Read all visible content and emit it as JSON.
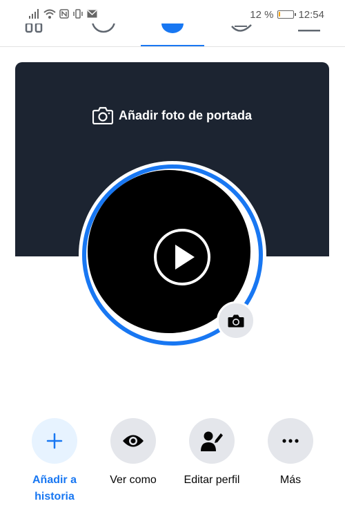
{
  "status_bar": {
    "battery_percent": "12 %",
    "battery_level": 0.12,
    "time": "12:54",
    "icons": [
      "signal-icon",
      "wifi-icon",
      "nfc-icon",
      "vibrate-icon",
      "mail-icon"
    ]
  },
  "nav": {
    "tabs": [
      "home-icon",
      "profile-icon",
      "watch-icon",
      "notifications-icon",
      "menu-icon"
    ],
    "active_index": 2
  },
  "cover": {
    "add_cover_label": "Añadir foto de portada"
  },
  "profile": {
    "ring_color": "#1877f2"
  },
  "actions": [
    {
      "label": "Añadir a historia",
      "icon": "plus-icon",
      "primary": true
    },
    {
      "label": "Ver como",
      "icon": "eye-icon",
      "primary": false
    },
    {
      "label": "Editar perfil",
      "icon": "edit-profile-icon",
      "primary": false
    },
    {
      "label": "Más",
      "icon": "more-icon",
      "primary": false
    }
  ],
  "colors": {
    "accent": "#1877f2",
    "cover_bg": "#1c2431",
    "button_bg": "#e4e6eb",
    "primary_button_bg": "#e7f3ff",
    "battery": "#f5a000"
  }
}
